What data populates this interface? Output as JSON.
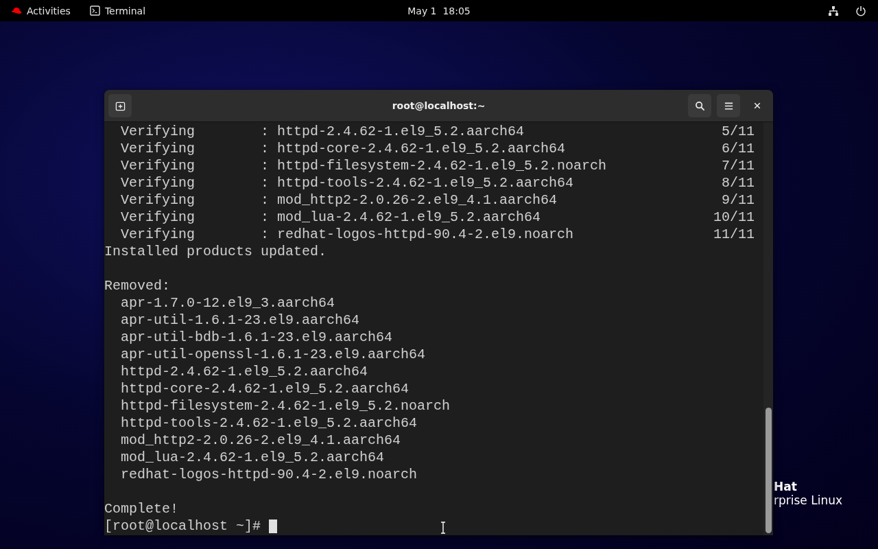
{
  "top_bar": {
    "activities": "Activities",
    "app": "Terminal",
    "clock": "May 1  18:05"
  },
  "desktop_logo": {
    "line_1": "Hat",
    "line_2": "rprise Linux"
  },
  "window": {
    "title": "root@localhost:~"
  },
  "terminal": {
    "lines": [
      {
        "kind": "verify",
        "text": "  Verifying        : httpd-2.4.62-1.el9_5.2.aarch64",
        "count": "5/11"
      },
      {
        "kind": "verify",
        "text": "  Verifying        : httpd-core-2.4.62-1.el9_5.2.aarch64",
        "count": "6/11"
      },
      {
        "kind": "verify",
        "text": "  Verifying        : httpd-filesystem-2.4.62-1.el9_5.2.noarch",
        "count": "7/11"
      },
      {
        "kind": "verify",
        "text": "  Verifying        : httpd-tools-2.4.62-1.el9_5.2.aarch64",
        "count": "8/11"
      },
      {
        "kind": "verify",
        "text": "  Verifying        : mod_http2-2.0.26-2.el9_4.1.aarch64",
        "count": "9/11"
      },
      {
        "kind": "verify",
        "text": "  Verifying        : mod_lua-2.4.62-1.el9_5.2.aarch64",
        "count": "10/11"
      },
      {
        "kind": "verify",
        "text": "  Verifying        : redhat-logos-httpd-90.4-2.el9.noarch",
        "count": "11/11"
      },
      {
        "kind": "text",
        "text": "Installed products updated."
      },
      {
        "kind": "blank"
      },
      {
        "kind": "text",
        "text": "Removed:"
      },
      {
        "kind": "text",
        "text": "  apr-1.7.0-12.el9_3.aarch64"
      },
      {
        "kind": "text",
        "text": "  apr-util-1.6.1-23.el9.aarch64"
      },
      {
        "kind": "text",
        "text": "  apr-util-bdb-1.6.1-23.el9.aarch64"
      },
      {
        "kind": "text",
        "text": "  apr-util-openssl-1.6.1-23.el9.aarch64"
      },
      {
        "kind": "text",
        "text": "  httpd-2.4.62-1.el9_5.2.aarch64"
      },
      {
        "kind": "text",
        "text": "  httpd-core-2.4.62-1.el9_5.2.aarch64"
      },
      {
        "kind": "text",
        "text": "  httpd-filesystem-2.4.62-1.el9_5.2.noarch"
      },
      {
        "kind": "text",
        "text": "  httpd-tools-2.4.62-1.el9_5.2.aarch64"
      },
      {
        "kind": "text",
        "text": "  mod_http2-2.0.26-2.el9_4.1.aarch64"
      },
      {
        "kind": "text",
        "text": "  mod_lua-2.4.62-1.el9_5.2.aarch64"
      },
      {
        "kind": "text",
        "text": "  redhat-logos-httpd-90.4-2.el9.noarch"
      },
      {
        "kind": "blank"
      },
      {
        "kind": "text",
        "text": "Complete!"
      },
      {
        "kind": "prompt",
        "text": "[root@localhost ~]# "
      }
    ]
  }
}
